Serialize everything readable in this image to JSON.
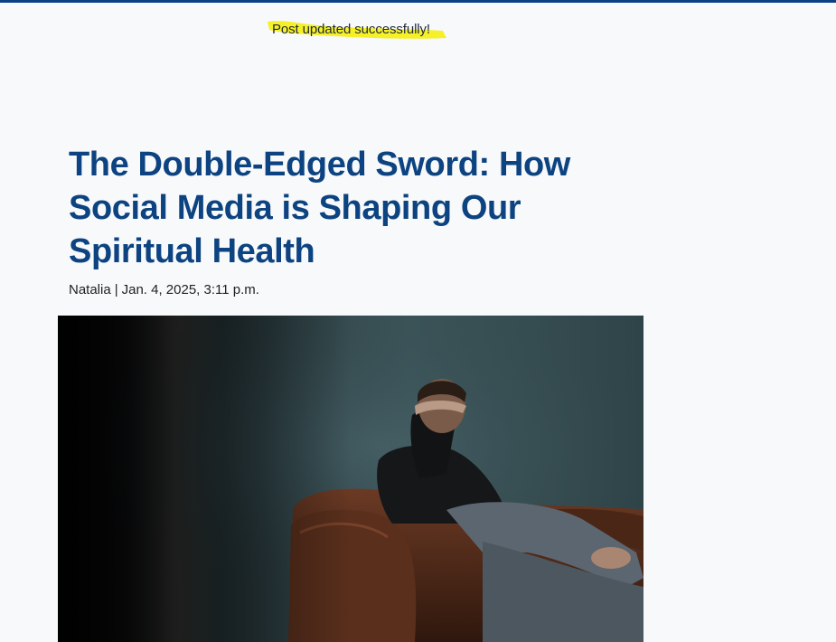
{
  "flash": {
    "message": "Post updated successfully!",
    "highlight_color": "#f5ef1e"
  },
  "post": {
    "title": "The Double-Edged Sword: How Social Media is Shaping Our Spiritual Health",
    "author": "Natalia",
    "separator": "|",
    "date": "Jan. 4, 2025, 3:11 p.m."
  },
  "hero_image": {
    "subject": "man-on-leather-armchair-photo"
  },
  "colors": {
    "title": "#0c4380",
    "top_rule": "#0d3f86",
    "background": "#f7f9fb"
  }
}
